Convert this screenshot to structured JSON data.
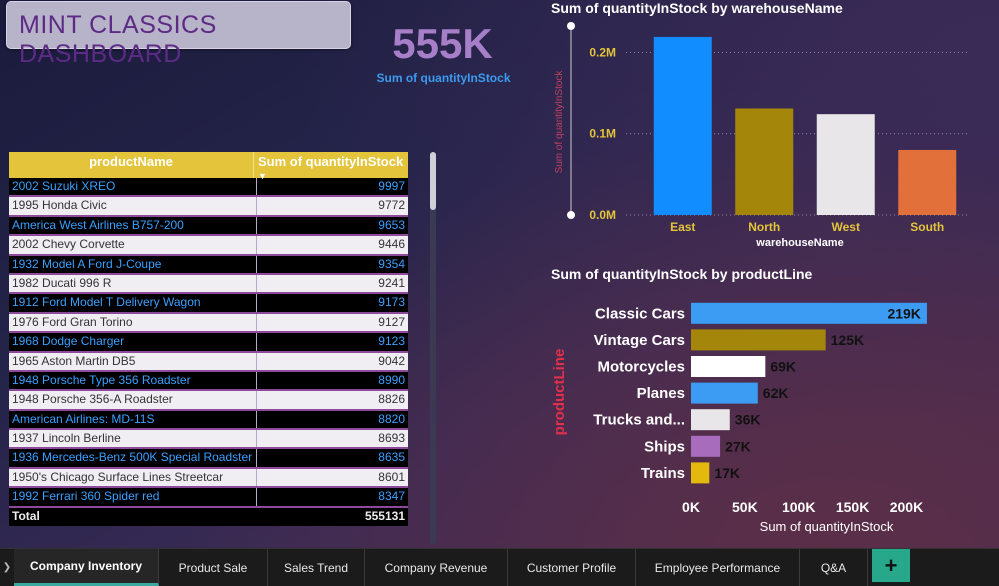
{
  "dashboard": {
    "title": "MINT CLASSICS DASHBOARD",
    "kpi": {
      "value": "555K",
      "label": "Sum of quantityInStock"
    }
  },
  "table": {
    "columns": [
      "productName",
      "Sum of quantityInStock"
    ],
    "rows": [
      {
        "name": "2002 Suzuki XREO",
        "qty": "9997"
      },
      {
        "name": "1995 Honda Civic",
        "qty": "9772"
      },
      {
        "name": "America West Airlines B757-200",
        "qty": "9653"
      },
      {
        "name": "2002 Chevy Corvette",
        "qty": "9446"
      },
      {
        "name": "1932 Model A Ford J-Coupe",
        "qty": "9354"
      },
      {
        "name": "1982 Ducati 996 R",
        "qty": "9241"
      },
      {
        "name": "1912 Ford Model T Delivery Wagon",
        "qty": "9173"
      },
      {
        "name": "1976 Ford Gran Torino",
        "qty": "9127"
      },
      {
        "name": "1968 Dodge Charger",
        "qty": "9123"
      },
      {
        "name": "1965 Aston Martin DB5",
        "qty": "9042"
      },
      {
        "name": "1948 Porsche Type 356 Roadster",
        "qty": "8990"
      },
      {
        "name": "1948 Porsche 356-A Roadster",
        "qty": "8826"
      },
      {
        "name": "American Airlines: MD-11S",
        "qty": "8820"
      },
      {
        "name": "1937 Lincoln Berline",
        "qty": "8693"
      },
      {
        "name": "1936 Mercedes-Benz 500K Special Roadster",
        "qty": "8635"
      },
      {
        "name": "1950's Chicago Surface Lines Streetcar",
        "qty": "8601"
      },
      {
        "name": "1992 Ferrari 360 Spider red",
        "qty": "8347"
      }
    ],
    "total_label": "Total",
    "total_value": "555131"
  },
  "chart_data": [
    {
      "type": "bar",
      "title": "Sum of quantityInStock by warehouseName",
      "xlabel": "warehouseName",
      "ylabel": "Sum of quantityInStock",
      "categories": [
        "East",
        "North",
        "West",
        "South"
      ],
      "values": [
        219000,
        131000,
        124000,
        80000
      ],
      "colors": [
        "#118dff",
        "#a4870a",
        "#e9e6ea",
        "#e2703b"
      ],
      "yticks": [
        "0.0M",
        "0.1M",
        "0.2M"
      ],
      "ytick_values": [
        0,
        100000,
        200000
      ],
      "ylim": [
        0,
        230000
      ],
      "grid": true
    },
    {
      "type": "bar",
      "orientation": "horizontal",
      "title": "Sum of quantityInStock by productLine",
      "xlabel": "Sum of quantityInStock",
      "ylabel": "productLine",
      "categories": [
        "Classic Cars",
        "Vintage Cars",
        "Motorcycles",
        "Planes",
        "Trucks and...",
        "Ships",
        "Trains"
      ],
      "values": [
        219000,
        125000,
        69000,
        62000,
        36000,
        27000,
        17000
      ],
      "data_labels": [
        "219K",
        "125K",
        "69K",
        "62K",
        "36K",
        "27K",
        "17K"
      ],
      "colors": [
        "#3c9cf4",
        "#a4870a",
        "#ffffff",
        "#3c9cf4",
        "#e9e6ea",
        "#a86cbc",
        "#e3b90e"
      ],
      "xticks": [
        "0K",
        "50K",
        "100K",
        "150K",
        "200K"
      ],
      "xtick_values": [
        0,
        50000,
        100000,
        150000,
        200000
      ],
      "xlim": [
        0,
        220000
      ]
    }
  ],
  "tabs": [
    {
      "label": "Company Inventory",
      "active": true
    },
    {
      "label": "Product Sale"
    },
    {
      "label": "Sales Trend"
    },
    {
      "label": "Company Revenue"
    },
    {
      "label": "Customer Profile"
    },
    {
      "label": "Employee Performance"
    },
    {
      "label": "Q&A"
    }
  ],
  "add_tab_label": "+",
  "nav_icon": "chevron-right-icon"
}
